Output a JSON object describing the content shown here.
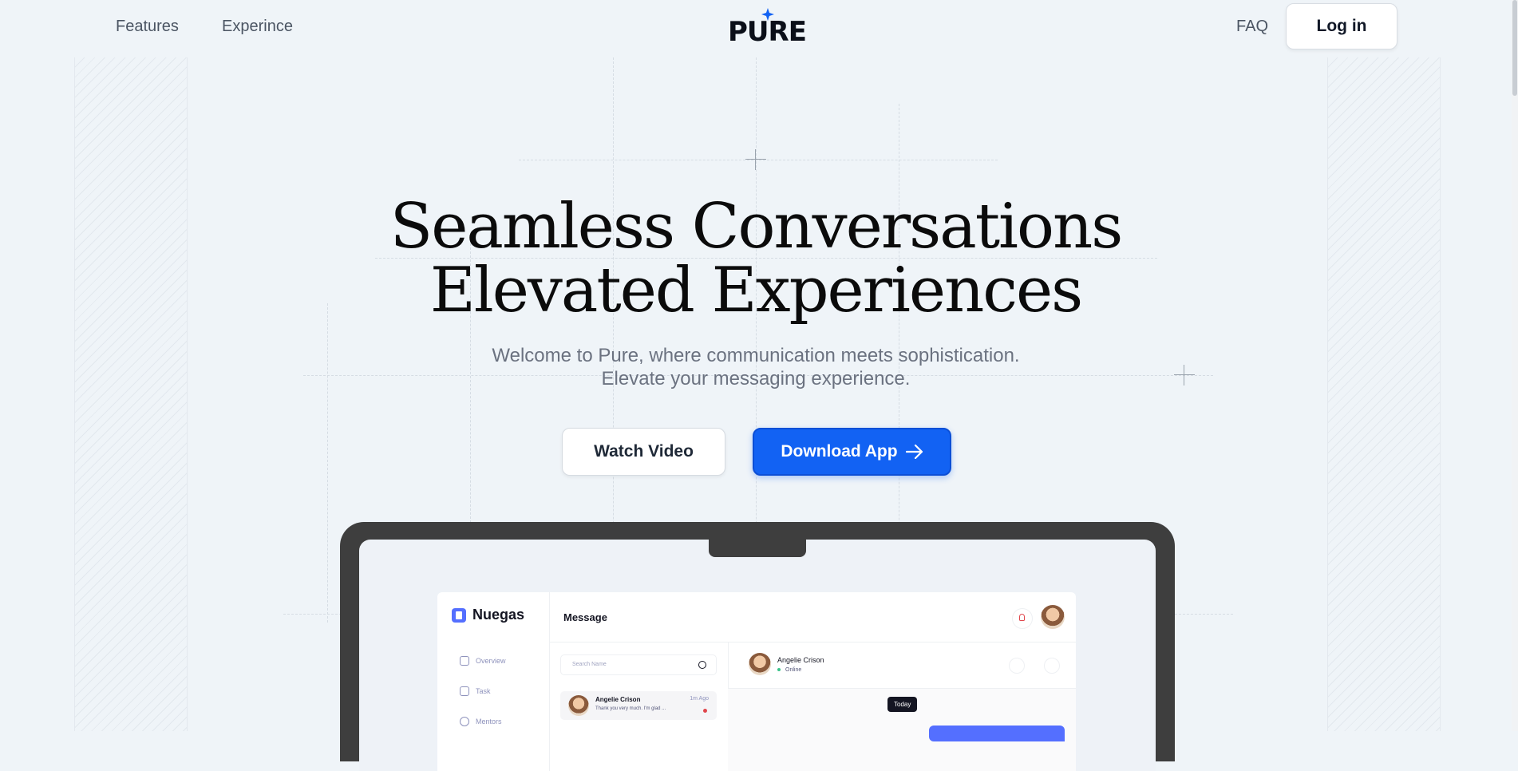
{
  "nav": {
    "features": "Features",
    "experience": "Experince",
    "logo": "PURE",
    "faq": "FAQ",
    "login": "Log in"
  },
  "hero": {
    "title_line1": "Seamless Conversations",
    "title_line2": "Elevated Experiences",
    "subtitle_line1": "Welcome to Pure, where communication meets sophistication.",
    "subtitle_line2": "Elevate your messaging experience.",
    "watch_video": "Watch Video",
    "download_app": "Download App"
  },
  "colors": {
    "primary": "#1262f3",
    "background": "#eff4f8",
    "app_accent": "#546fff"
  },
  "app_preview": {
    "brand": "Nuegas",
    "page_title": "Message",
    "sidebar": [
      "Overview",
      "Task",
      "Mentors"
    ],
    "search_placeholder": "Search Name",
    "conversation": {
      "name": "Angelie Crison",
      "time": "1m Ago",
      "message": "Thank you very much. I'm glad ..."
    },
    "chat": {
      "name": "Angelie Crison",
      "status": "Online",
      "day_label": "Today"
    }
  }
}
